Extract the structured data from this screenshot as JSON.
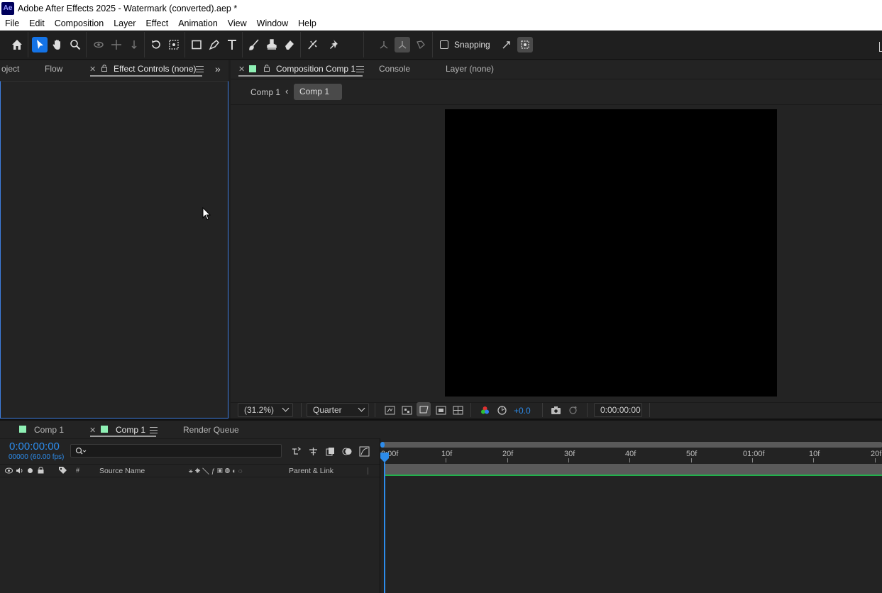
{
  "window": {
    "title": "Adobe After Effects 2025 - Watermark (converted).aep *",
    "app_badge": "Ae"
  },
  "menu": [
    "File",
    "Edit",
    "Composition",
    "Layer",
    "Effect",
    "Animation",
    "View",
    "Window",
    "Help"
  ],
  "toolbar": {
    "tools": [
      "home-icon",
      "selection-tool-icon",
      "hand-tool-icon",
      "zoom-tool-icon",
      "orbit-camera-icon",
      "pan-camera-icon",
      "dolly-camera-icon",
      "rotation-tool-icon",
      "pan-behind-tool-icon",
      "rectangle-tool-icon",
      "pen-tool-icon",
      "type-tool-icon",
      "brush-tool-icon",
      "clone-stamp-icon",
      "eraser-tool-icon",
      "roto-brush-icon",
      "puppet-pin-icon"
    ],
    "axis_modes": [
      "local-axis-icon",
      "world-axis-icon",
      "view-axis-icon"
    ],
    "snapping_label": "Snapping"
  },
  "left_panel": {
    "tabs": [
      {
        "label": "oject"
      },
      {
        "label": "Flow"
      },
      {
        "label": "Effect Controls (none)"
      }
    ],
    "overflow_icon": "double-chevron-right-icon"
  },
  "viewer_panel": {
    "tabs": [
      {
        "label": "Composition Comp 1"
      },
      {
        "label": "Console"
      },
      {
        "label": "Layer (none)"
      }
    ],
    "breadcrumb": [
      "Comp 1",
      "Comp 1"
    ],
    "zoom": "(31.2%)",
    "resolution": "Quarter",
    "exposure": "+0.0",
    "timecode": "0:00:00:00",
    "canvas_color": "#000000"
  },
  "timeline": {
    "tabs": [
      {
        "label": "Comp 1"
      },
      {
        "label": "Comp 1"
      },
      {
        "label": "Render Queue"
      }
    ],
    "timecode": "0:00:00:00",
    "frame_info": "00000 (60.00 fps)",
    "search_placeholder": "",
    "ruler": [
      "0:00f",
      "10f",
      "20f",
      "30f",
      "40f",
      "50f",
      "01:00f",
      "10f",
      "20f"
    ],
    "columns": {
      "number": "#",
      "source_name": "Source Name",
      "parent": "Parent & Link"
    },
    "accent": "#2d8ceb",
    "work_area_color": "#22b14c"
  }
}
